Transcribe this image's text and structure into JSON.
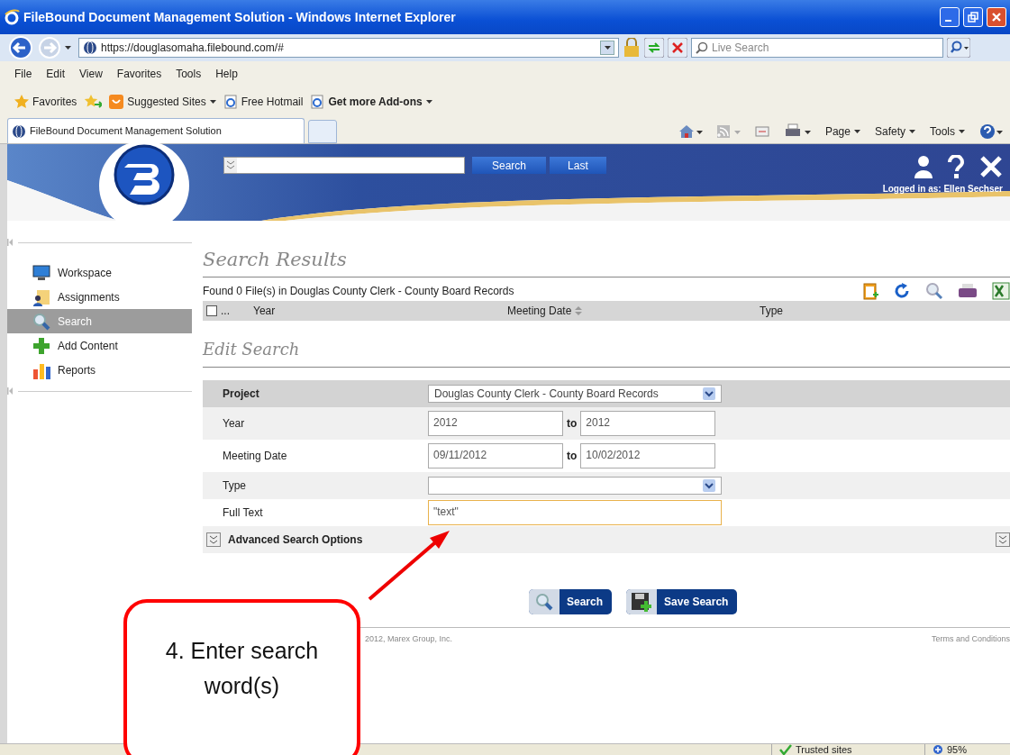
{
  "browser": {
    "title": "FileBound Document Management Solution - Windows Internet Explorer",
    "address": "https://douglasomaha.filebound.com/#",
    "search_placeholder": "Live Search",
    "menu": [
      "File",
      "Edit",
      "View",
      "Favorites",
      "Tools",
      "Help"
    ],
    "favorites": {
      "label": "Favorites",
      "links": [
        {
          "label": "Suggested Sites",
          "dropdown": true,
          "bold": false
        },
        {
          "label": "Free Hotmail",
          "dropdown": false,
          "bold": false
        },
        {
          "label": "Get more Add-ons",
          "dropdown": true,
          "bold": true
        }
      ]
    },
    "tab": "FileBound Document Management Solution",
    "commands": [
      "Page",
      "Safety",
      "Tools"
    ]
  },
  "header": {
    "search_button": "Search",
    "last_button": "Last",
    "logged_in": "Logged in as: Ellen Sechser"
  },
  "sidebar": {
    "items": [
      {
        "label": "Workspace",
        "selected": false
      },
      {
        "label": "Assignments",
        "selected": false
      },
      {
        "label": "Search",
        "selected": true
      },
      {
        "label": "Add Content",
        "selected": false
      },
      {
        "label": "Reports",
        "selected": false
      }
    ]
  },
  "results": {
    "title": "Search Results",
    "found": "Found 0 File(s) in Douglas County Clerk - County Board Records",
    "select_all_checked": false,
    "columns": [
      "...",
      "Year",
      "Meeting Date",
      "Type"
    ]
  },
  "edit_search": {
    "title": "Edit Search",
    "fields": [
      {
        "label": "Project",
        "kind": "select",
        "value": "Douglas County Clerk - County Board Records",
        "focused": false
      },
      {
        "label": "Year",
        "kind": "range",
        "from": "2012",
        "joiner": "to",
        "to": "2012",
        "focused": false
      },
      {
        "label": "Meeting Date",
        "kind": "range",
        "from": "09/11/2012",
        "joiner": "to",
        "to": "10/02/2012",
        "focused": false
      },
      {
        "label": "Type",
        "kind": "select",
        "focused": false
      },
      {
        "label": "Full Text",
        "kind": "text",
        "value": "\"text\"",
        "focused": true
      }
    ],
    "advanced": "Advanced Search Options",
    "buttons": [
      {
        "label": "Search"
      },
      {
        "label": "Save Search"
      }
    ]
  },
  "footer": {
    "copyright": "2012, Marex Group, Inc.",
    "terms": "Terms and Conditions"
  },
  "callout": "4. Enter search word(s)",
  "status_bar": {
    "zone": "Trusted sites",
    "zoom": "95%"
  }
}
